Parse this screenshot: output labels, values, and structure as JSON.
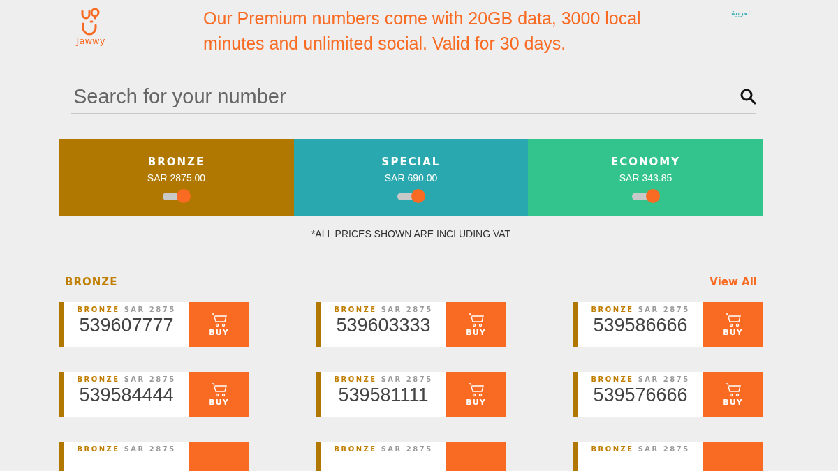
{
  "header": {
    "logo_text": "Jawwy",
    "headline": "Our Premium numbers come with 20GB data, 3000 local minutes and unlimited social. Valid for 30 days.",
    "language_link": "العربية"
  },
  "search": {
    "placeholder": "Search for your number"
  },
  "tiers": [
    {
      "name": "BRONZE",
      "price": "SAR 2875.00",
      "on": true,
      "color": "#b07800"
    },
    {
      "name": "SPECIAL",
      "price": "SAR 690.00",
      "on": true,
      "color": "#2aa8b0"
    },
    {
      "name": "ECONOMY",
      "price": "SAR 343.85",
      "on": true,
      "color": "#33c48d"
    }
  ],
  "vat_note": "*ALL PRICES SHOWN ARE INCLUDING VAT",
  "section": {
    "title": "BRONZE",
    "view_all": "View All",
    "numbers": [
      {
        "tier": "BRONZE",
        "price": "SAR 2875",
        "number": "539607777",
        "buy": "BUY"
      },
      {
        "tier": "BRONZE",
        "price": "SAR 2875",
        "number": "539603333",
        "buy": "BUY"
      },
      {
        "tier": "BRONZE",
        "price": "SAR 2875",
        "number": "539586666",
        "buy": "BUY"
      },
      {
        "tier": "BRONZE",
        "price": "SAR 2875",
        "number": "539584444",
        "buy": "BUY"
      },
      {
        "tier": "BRONZE",
        "price": "SAR 2875",
        "number": "539581111",
        "buy": "BUY"
      },
      {
        "tier": "BRONZE",
        "price": "SAR 2875",
        "number": "539576666",
        "buy": "BUY"
      },
      {
        "tier": "BRONZE",
        "price": "SAR 2875"
      },
      {
        "tier": "BRONZE",
        "price": "SAR 2875"
      },
      {
        "tier": "BRONZE",
        "price": "SAR 2875"
      }
    ]
  }
}
